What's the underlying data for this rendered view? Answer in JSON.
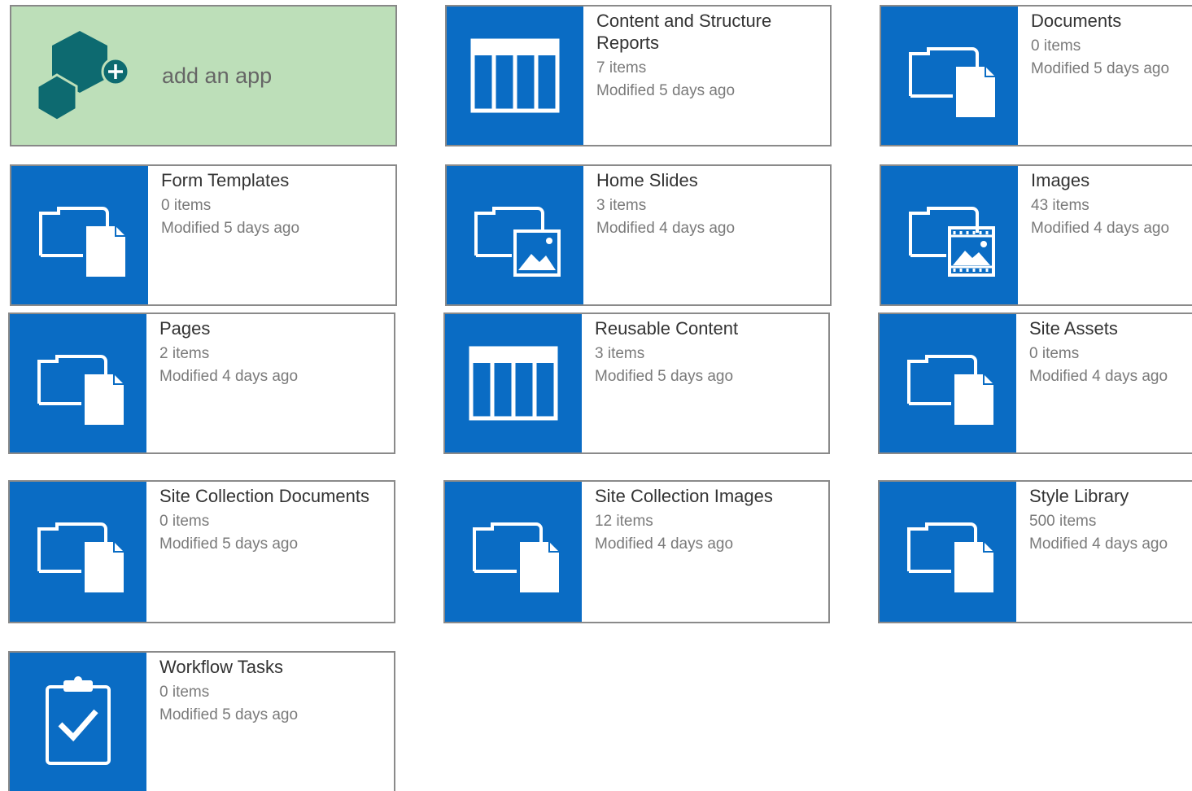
{
  "add_app": {
    "label": "add an app"
  },
  "apps": [
    {
      "title": "Content and Structure Reports",
      "count": "7 items",
      "modified": "Modified 5 days ago",
      "icon": "list-icon"
    },
    {
      "title": "Documents",
      "count": "0 items",
      "modified": "Modified 5 days ago",
      "icon": "document-library-icon"
    },
    {
      "title": "Form Templates",
      "count": "0 items",
      "modified": "Modified 5 days ago",
      "icon": "document-library-icon"
    },
    {
      "title": "Home Slides",
      "count": "3 items",
      "modified": "Modified 4 days ago",
      "icon": "picture-library-icon"
    },
    {
      "title": "Images",
      "count": "43 items",
      "modified": "Modified 4 days ago",
      "icon": "asset-library-icon"
    },
    {
      "title": "Pages",
      "count": "2 items",
      "modified": "Modified 4 days ago",
      "icon": "document-library-icon"
    },
    {
      "title": "Reusable Content",
      "count": "3 items",
      "modified": "Modified 5 days ago",
      "icon": "list-icon"
    },
    {
      "title": "Site Assets",
      "count": "0 items",
      "modified": "Modified 4 days ago",
      "icon": "document-library-icon"
    },
    {
      "title": "Site Collection Documents",
      "count": "0 items",
      "modified": "Modified 5 days ago",
      "icon": "document-library-icon"
    },
    {
      "title": "Site Collection Images",
      "count": "12 items",
      "modified": "Modified 4 days ago",
      "icon": "document-library-icon"
    },
    {
      "title": "Style Library",
      "count": "500 items",
      "modified": "Modified 4 days ago",
      "icon": "document-library-icon"
    },
    {
      "title": "Workflow Tasks",
      "count": "0 items",
      "modified": "Modified 5 days ago",
      "icon": "task-list-icon"
    }
  ],
  "colors": {
    "tile_blue": "#0a6cc4",
    "add_tile_green": "#bddfb9",
    "title_text": "#333333",
    "meta_text": "#7a7a7a"
  }
}
